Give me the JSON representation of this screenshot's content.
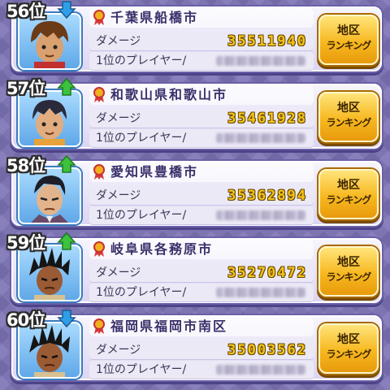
{
  "entries": [
    {
      "rank": "56位",
      "trend": "down",
      "city": "千葉県船橋市",
      "damage_label": "ダメージ",
      "damage": "35511940",
      "player_label": "1位のプレイヤー/",
      "button_line1": "地区",
      "button_line2": "ランキング",
      "avatar": "brown-haired-boy-avatar-icon"
    },
    {
      "rank": "57位",
      "trend": "up",
      "city": "和歌山県和歌山市",
      "damage_label": "ダメージ",
      "damage": "35461928",
      "player_label": "1位のプレイヤー/",
      "button_line1": "地区",
      "button_line2": "ランキング",
      "avatar": "dark-haired-boy-avatar-icon"
    },
    {
      "rank": "58位",
      "trend": "up",
      "city": "愛知県豊橋市",
      "damage_label": "ダメージ",
      "damage": "35362894",
      "player_label": "1位のプレイヤー/",
      "button_line1": "地区",
      "button_line2": "ランキング",
      "avatar": "suited-man-avatar-icon"
    },
    {
      "rank": "59位",
      "trend": "up",
      "city": "岐阜県各務原市",
      "damage_label": "ダメージ",
      "damage": "35270472",
      "player_label": "1位のプレイヤー/",
      "button_line1": "地区",
      "button_line2": "ランキング",
      "avatar": "spiky-haired-warrior-avatar-icon"
    },
    {
      "rank": "60位",
      "trend": "down",
      "city": "福岡県福岡市南区",
      "damage_label": "ダメージ",
      "damage": "35003562",
      "player_label": "1位のプレイヤー/",
      "button_line1": "地区",
      "button_line2": "ランキング",
      "avatar": "spiky-haired-warrior-avatar-icon"
    }
  ],
  "colors": {
    "trend_up": "#3cc23c",
    "trend_down": "#2f9ee8",
    "damage_value": "#f5c51c",
    "button": "#f7b820"
  }
}
